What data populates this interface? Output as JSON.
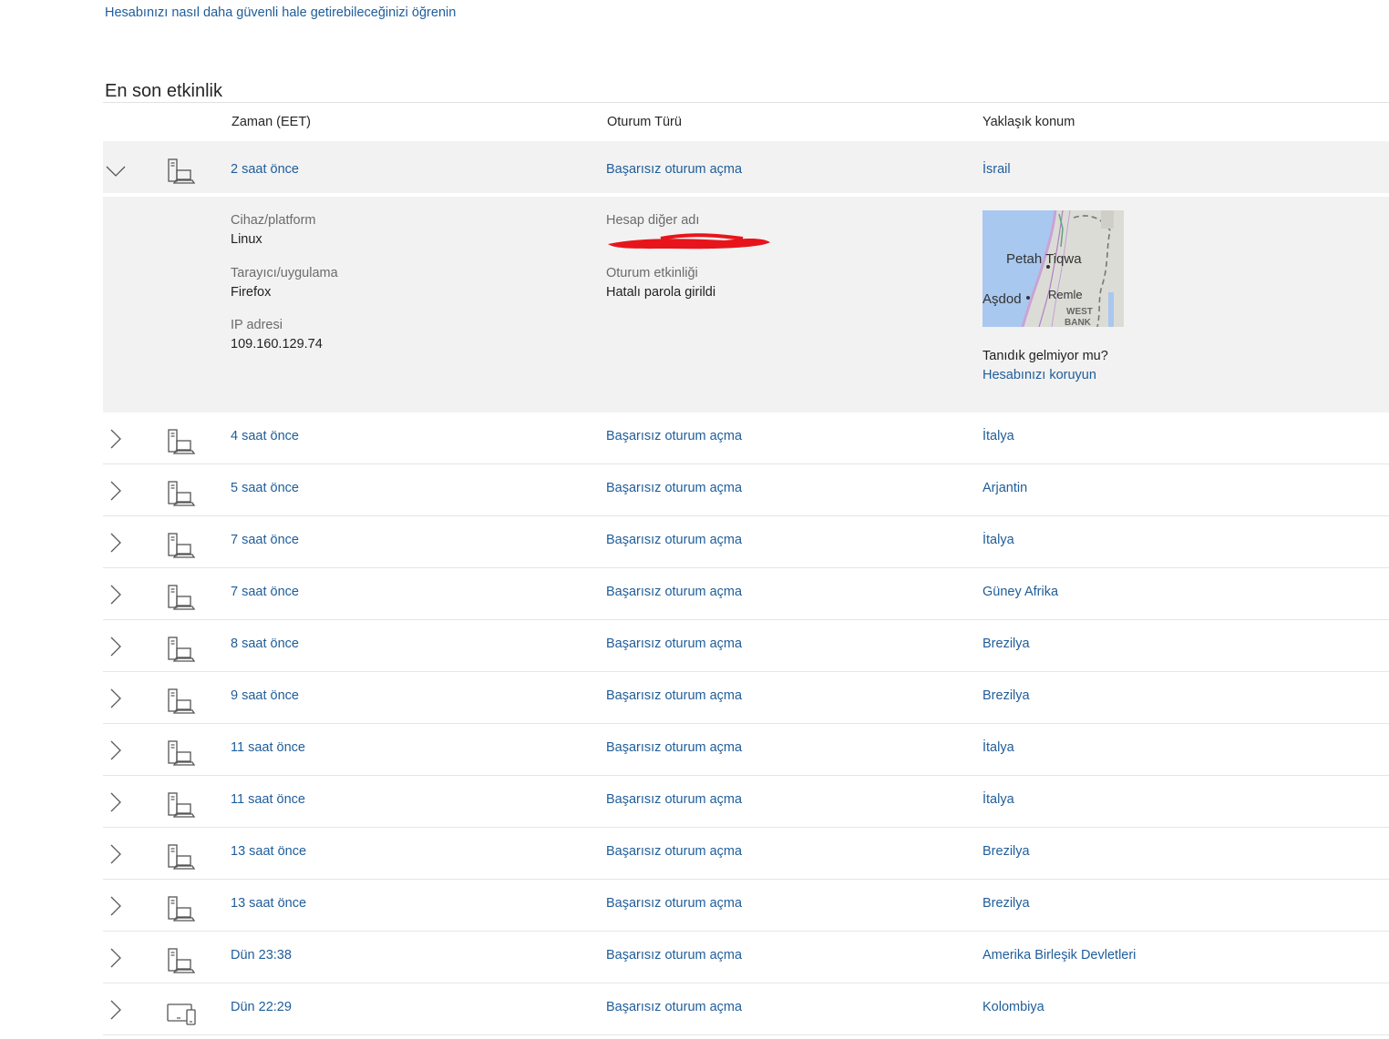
{
  "top_link": "Hesabınızı nasıl daha güvenli hale getirebileceğinizi öğrenin",
  "section_title": "En son etkinlik",
  "columns": {
    "time": "Zaman (EET)",
    "type": "Oturum Türü",
    "location": "Yaklaşık konum"
  },
  "expanded_row": {
    "time": "2 saat önce",
    "type": "Başarısız oturum açma",
    "location": "İsrail",
    "device_icon": "desktop-laptop-icon",
    "details": {
      "device_label": "Cihaz/platform",
      "device_value": "Linux",
      "browser_label": "Tarayıcı/uygulama",
      "browser_value": "Firefox",
      "ip_label": "IP adresi",
      "ip_value": "109.160.129.74",
      "alias_label": "Hesap diğer adı",
      "activity_label": "Oturum etkinliği",
      "activity_value": "Hatalı parola girildi",
      "map_labels": {
        "city1": "Petah Tiqwa",
        "city2": "Aşdod",
        "city3": "Remle",
        "region1": "WEST",
        "region2": "BANK"
      },
      "unfamiliar": "Tanıdık gelmiyor mu?",
      "protect_link": "Hesabınızı koruyun"
    }
  },
  "rows": [
    {
      "time": "4 saat önce",
      "type": "Başarısız oturum açma",
      "location": "İtalya",
      "device_icon": "desktop-laptop-icon"
    },
    {
      "time": "5 saat önce",
      "type": "Başarısız oturum açma",
      "location": "Arjantin",
      "device_icon": "desktop-laptop-icon"
    },
    {
      "time": "7 saat önce",
      "type": "Başarısız oturum açma",
      "location": "İtalya",
      "device_icon": "desktop-laptop-icon"
    },
    {
      "time": "7 saat önce",
      "type": "Başarısız oturum açma",
      "location": "Güney Afrika",
      "device_icon": "desktop-laptop-icon"
    },
    {
      "time": "8 saat önce",
      "type": "Başarısız oturum açma",
      "location": "Brezilya",
      "device_icon": "desktop-laptop-icon"
    },
    {
      "time": "9 saat önce",
      "type": "Başarısız oturum açma",
      "location": "Brezilya",
      "device_icon": "desktop-laptop-icon"
    },
    {
      "time": "11 saat önce",
      "type": "Başarısız oturum açma",
      "location": "İtalya",
      "device_icon": "desktop-laptop-icon"
    },
    {
      "time": "11 saat önce",
      "type": "Başarısız oturum açma",
      "location": "İtalya",
      "device_icon": "desktop-laptop-icon"
    },
    {
      "time": "13 saat önce",
      "type": "Başarısız oturum açma",
      "location": "Brezilya",
      "device_icon": "desktop-laptop-icon"
    },
    {
      "time": "13 saat önce",
      "type": "Başarısız oturum açma",
      "location": "Brezilya",
      "device_icon": "desktop-laptop-icon"
    },
    {
      "time": "Dün 23:38",
      "type": "Başarısız oturum açma",
      "location": "Amerika Birleşik Devletleri",
      "device_icon": "desktop-laptop-icon"
    },
    {
      "time": "Dün 22:29",
      "type": "Başarısız oturum açma",
      "location": "Kolombiya",
      "device_icon": "tablet-phone-icon"
    }
  ],
  "colors": {
    "link": "#1f5d9a",
    "expanded_bg": "#f2f2f2",
    "redaction": "#e8141b"
  }
}
